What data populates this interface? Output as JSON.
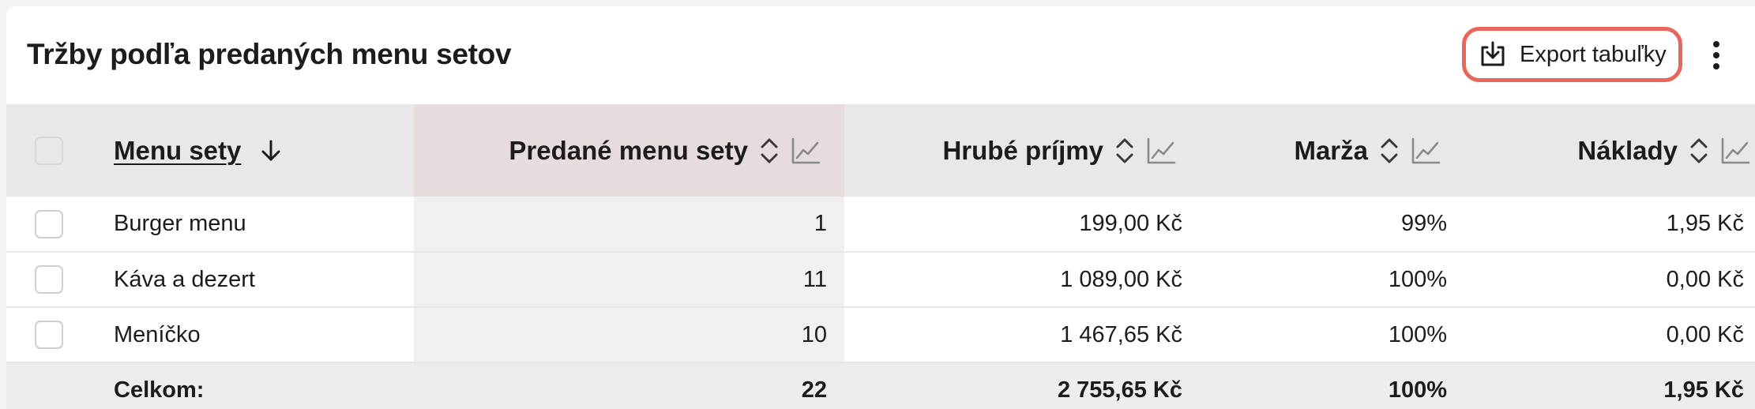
{
  "header": {
    "title": "Tržby podľa predaných menu setov",
    "export_label": "Export tabuľky"
  },
  "table": {
    "columns": {
      "name": "Menu sety",
      "sold": "Predané menu sety",
      "gross": "Hrubé príjmy",
      "margin": "Marža",
      "costs": "Náklady"
    },
    "rows": [
      {
        "name": "Burger menu",
        "sold": "1",
        "gross": "199,00 Kč",
        "margin": "99%",
        "costs": "1,95 Kč"
      },
      {
        "name": "Káva a dezert",
        "sold": "11",
        "gross": "1 089,00 Kč",
        "margin": "100%",
        "costs": "0,00 Kč"
      },
      {
        "name": "Meníčko",
        "sold": "10",
        "gross": "1 467,65 Kč",
        "margin": "100%",
        "costs": "0,00 Kč"
      }
    ],
    "total": {
      "label": "Celkom:",
      "sold": "22",
      "gross": "2 755,65 Kč",
      "margin": "100%",
      "costs": "1,95 Kč"
    }
  },
  "colors": {
    "accent_outline": "#e8675a",
    "header_bg": "#e8e8ea",
    "sorted_column_header_bg": "#e6dcdb",
    "sorted_column_bg": "#f0f0f1"
  },
  "icons": {
    "export": "download-tray-icon",
    "more": "vertical-dots-icon",
    "sort_active": "arrow-down-icon",
    "sort": "sort-updown-icon",
    "chart": "line-chart-icon"
  }
}
